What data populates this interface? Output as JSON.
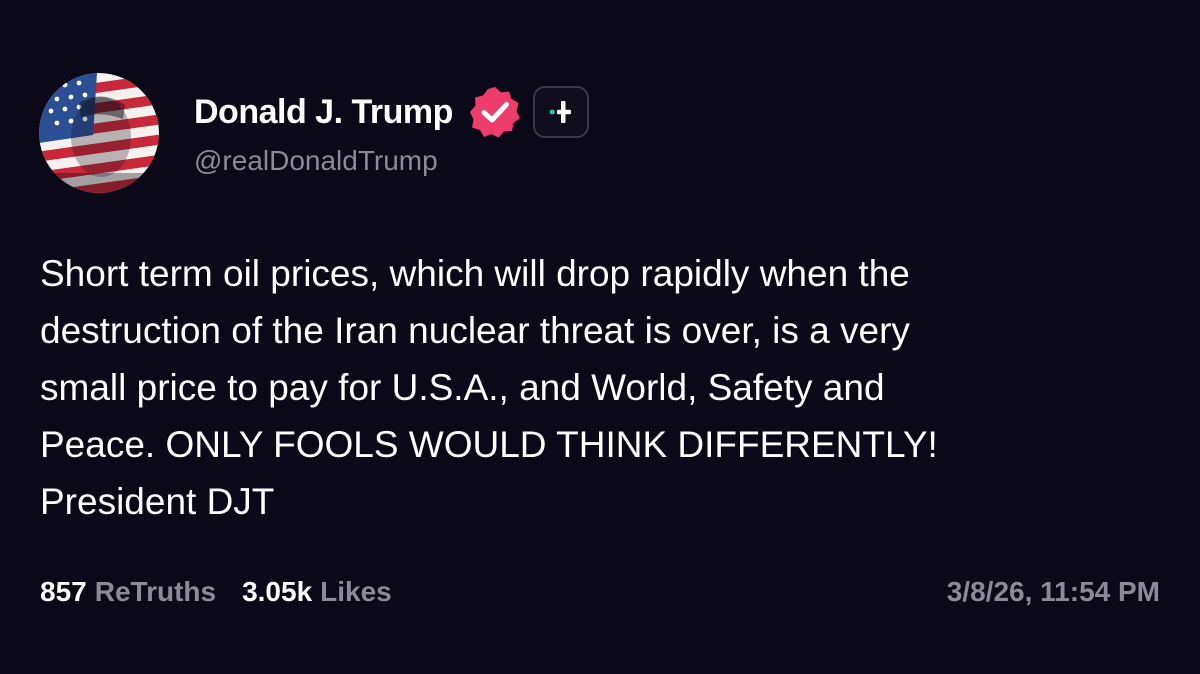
{
  "post": {
    "author": {
      "display_name": "Donald J. Trump",
      "handle": "@realDonaldTrump",
      "avatar": "american-flag-portrait",
      "verified_icon": "verified-badge-icon",
      "verified_color": "#ee3d6c",
      "action_icon": "plus-icon",
      "action_accent": "#21c4b0"
    },
    "text": "Short term oil prices, which will drop rapidly when the\ndestruction of the Iran nuclear threat is over, is a very\nsmall price to pay for U.S.A., and World, Safety and\nPeace. ONLY FOOLS WOULD THINK DIFFERENTLY!\nPresident DJT",
    "stats": {
      "retruths_count": "857",
      "retruths_label": "ReTruths",
      "likes_count": "3.05k",
      "likes_label": "Likes"
    },
    "timestamp": "3/8/26, 11:54 PM"
  },
  "colors": {
    "background": "#0b0818",
    "text_primary": "#ffffff",
    "text_secondary": "#8b8a97"
  }
}
